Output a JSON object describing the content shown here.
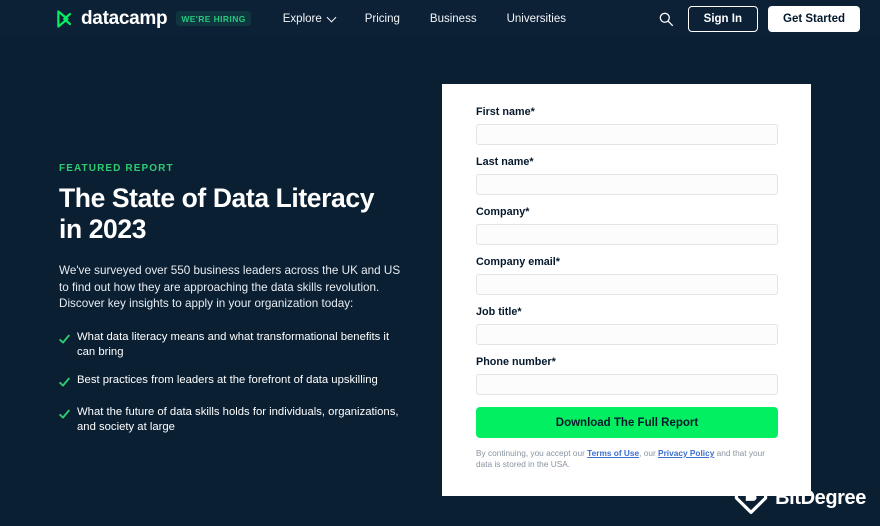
{
  "nav": {
    "brand_name": "datacamp",
    "brand_logo_icon": "datacamp-logo-icon",
    "hiring_badge": "WE'RE HIRING",
    "links": [
      {
        "label": "Explore",
        "has_chevron": true
      },
      {
        "label": "Pricing",
        "has_chevron": false
      },
      {
        "label": "Business",
        "has_chevron": false
      },
      {
        "label": "Universities",
        "has_chevron": false
      }
    ],
    "search_icon": "search-icon",
    "sign_in_label": "Sign In",
    "get_started_label": "Get Started"
  },
  "hero": {
    "eyebrow": "FEATURED REPORT",
    "title_line1": "The State of Data Literacy",
    "title_line2": "in 2023",
    "subtitle": "We've surveyed over 550 business leaders across the UK and US to find out how they are approaching the data skills revolution. Discover key insights to apply in your organization today:",
    "bullet_icon": "green-check-arrow-icon",
    "bullets": [
      "What data literacy means and what transformational benefits it can bring",
      "Best practices from leaders at the forefront of data upskilling",
      "What the future of data skills holds for individuals, organizations, and society at large"
    ]
  },
  "form": {
    "fields": [
      {
        "label": "First name*",
        "value": "",
        "placeholder": ""
      },
      {
        "label": "Last name*",
        "value": "",
        "placeholder": ""
      },
      {
        "label": "Company*",
        "value": "",
        "placeholder": ""
      },
      {
        "label": "Company email*",
        "value": "",
        "placeholder": ""
      },
      {
        "label": "Job title*",
        "value": "",
        "placeholder": ""
      },
      {
        "label": "Phone number*",
        "value": "",
        "placeholder": ""
      }
    ],
    "submit_label": "Download The Full Report",
    "legal": {
      "part1": "By continuing, you accept our ",
      "link1": "Terms of Use",
      "part2": ", our ",
      "link2": "Privacy Policy",
      "part3": " and that your data is stored in the USA."
    }
  },
  "watermark": {
    "text": "BitDegree",
    "logo_icon": "bitdegree-shield-logo-icon"
  },
  "colors": {
    "background_navy": "#0b1f33",
    "nav_navy": "#0c2036",
    "accent_green": "#03ef62",
    "eyebrow_green": "#2ecc71",
    "card_white": "#ffffff",
    "link_blue": "#3c6fcf"
  }
}
